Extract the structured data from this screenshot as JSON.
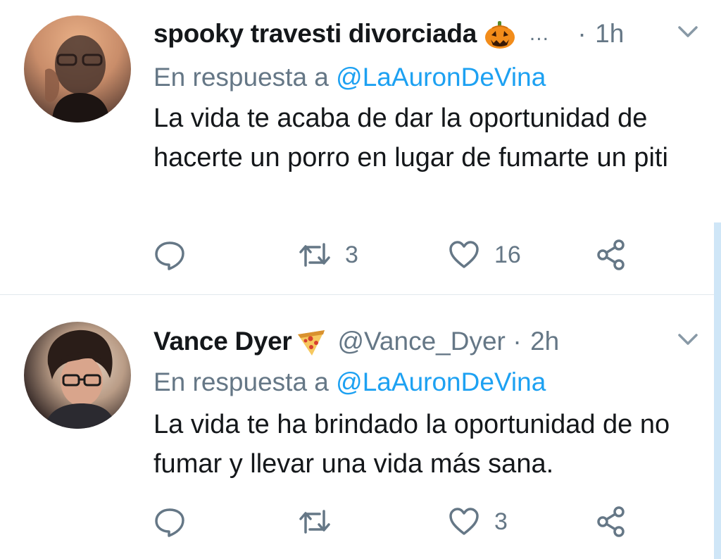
{
  "tweets": [
    {
      "display_name": "spooky travesti divorciada",
      "name_emoji": "jack-o-lantern",
      "name_truncated": "...",
      "handle": "",
      "time": "1h",
      "reply_prefix": "En respuesta a",
      "reply_mention": "@LaAuronDeVina",
      "text": "La vida te acaba de dar la oportunidad de hacerte un porro en lugar de fumarte un piti",
      "retweets": "3",
      "likes": "16"
    },
    {
      "display_name": "Vance Dyer",
      "name_emoji": "pizza",
      "handle": "@Vance_Dyer",
      "time": "2h",
      "reply_prefix": "En respuesta a",
      "reply_mention": "@LaAuronDeVina",
      "text": "La vida te ha brindado la oportunidad de no fumar y llevar una vida más sana.",
      "retweets": "",
      "likes": "3"
    }
  ],
  "icons": {
    "reply": "reply-icon",
    "retweet": "retweet-icon",
    "like": "heart-icon",
    "share": "share-icon",
    "menu": "chevron-down-icon"
  },
  "colors": {
    "accent": "#1da1f2",
    "secondary_text": "#657786",
    "primary_text": "#14171a",
    "divider": "#e1e8ed"
  }
}
